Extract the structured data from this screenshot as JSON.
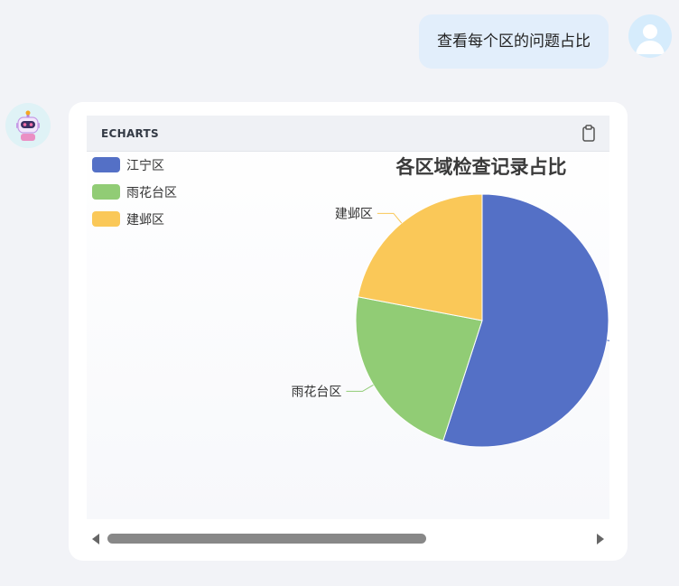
{
  "user_message": "查看每个区的问题占比",
  "chart_panel": {
    "header_label": "ECHARTS"
  },
  "colors": {
    "江宁区": "#5470c6",
    "雨花台区": "#91cc75",
    "建邺区": "#fac858"
  },
  "chart_data": {
    "type": "pie",
    "title": "各区域检查记录占比",
    "legend_position": "top-left",
    "categories": [
      "江宁区",
      "雨花台区",
      "建邺区"
    ],
    "values": [
      55,
      23,
      22
    ],
    "start_angle_deg": 90,
    "direction": "clockwise"
  }
}
